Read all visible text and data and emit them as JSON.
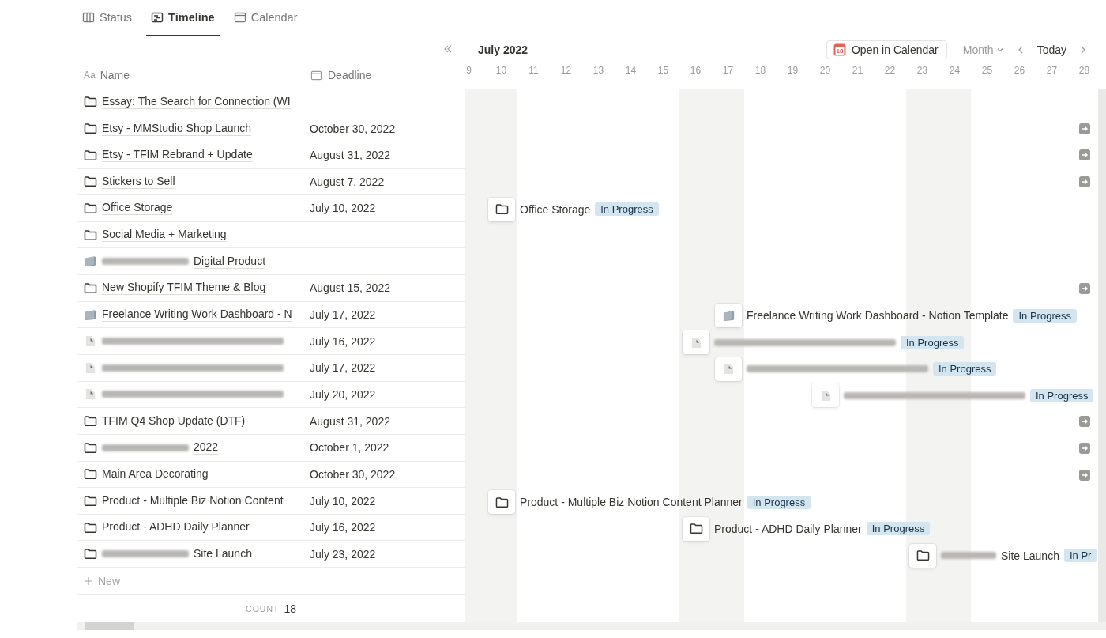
{
  "tabs": [
    {
      "label": "Status",
      "kind": "board",
      "selected": false
    },
    {
      "label": "Timeline",
      "kind": "timeline",
      "selected": true
    },
    {
      "label": "Calendar",
      "kind": "calendar",
      "selected": false
    }
  ],
  "columns": [
    {
      "label": "Name",
      "icon_text": "Aa"
    },
    {
      "label": "Deadline"
    }
  ],
  "rows": [
    {
      "name": "Essay: The Search for Connection (WI",
      "kind": "folder"
    },
    {
      "name": "Etsy - MMStudio Shop Launch",
      "kind": "folder",
      "deadline": "October 30, 2022",
      "beyond_range": true
    },
    {
      "name": "Etsy - TFIM Rebrand + Update",
      "kind": "folder",
      "deadline": "August 31, 2022",
      "beyond_range": true
    },
    {
      "name": "Stickers to Sell",
      "kind": "folder",
      "deadline": "August 7, 2022",
      "beyond_range": true
    },
    {
      "name": "Office Storage",
      "kind": "folder",
      "deadline": "July 10, 2022",
      "bar": {
        "title": "Office Storage",
        "status": "In Progress"
      }
    },
    {
      "name": "Social Media + Marketing",
      "kind": "folder"
    },
    {
      "name": "Digital Product",
      "kind": "gray-folder",
      "blurred": true
    },
    {
      "name": "New Shopify TFIM Theme & Blog",
      "kind": "folder",
      "deadline": "August 15, 2022",
      "beyond_range": true
    },
    {
      "name": "Freelance Writing Work Dashboard - N",
      "kind": "gray-folder",
      "deadline": "July 17, 2022",
      "bar": {
        "title": "Freelance Writing Work Dashboard - Notion Template",
        "status": "In Progress"
      }
    },
    {
      "kind": "document",
      "blurred": true,
      "deadline": "July 16, 2022",
      "bar": {
        "blurred": true,
        "status": "In Progress"
      }
    },
    {
      "kind": "document",
      "blurred": true,
      "deadline": "July 17, 2022",
      "bar": {
        "blurred": true,
        "status": "In Progress"
      }
    },
    {
      "kind": "document",
      "blurred": true,
      "deadline": "July 20, 2022",
      "bar": {
        "blurred": true,
        "status": "In Progress"
      }
    },
    {
      "name": "TFIM Q4 Shop Update (DTF)",
      "kind": "folder",
      "deadline": "August 31, 2022",
      "beyond_range": true
    },
    {
      "name": "2022",
      "kind": "folder",
      "blurred": true,
      "deadline": "October 1, 2022",
      "beyond_range": true
    },
    {
      "name": "Main Area Decorating",
      "kind": "folder",
      "deadline": "October 30, 2022",
      "beyond_range": true
    },
    {
      "name": "Product - Multiple Biz Notion Content",
      "kind": "folder",
      "deadline": "July 10, 2022",
      "bar": {
        "title": "Product - Multiple Biz Notion Content Planner",
        "status": "In Progress"
      }
    },
    {
      "name": "Product - ADHD Daily Planner",
      "kind": "folder",
      "deadline": "July 16, 2022",
      "bar": {
        "title": "Product - ADHD Daily Planner",
        "status": "In Progress"
      }
    },
    {
      "name": "Site Launch",
      "kind": "folder",
      "blurred": true,
      "deadline": "July 23, 2022",
      "bar": {
        "blurred": true,
        "title": "Site Launch",
        "status": "In Pr"
      }
    }
  ],
  "new_row": {
    "label": "New"
  },
  "count": {
    "label": "COUNT",
    "value": "18"
  },
  "timeline": {
    "month": "July 2022",
    "open_button": "Open in Calendar",
    "calendar_icon_day": "18",
    "view": "Month",
    "today": "Today",
    "days": [
      {
        "label": "9",
        "weekend": true
      },
      {
        "label": "10",
        "weekend": true
      },
      {
        "label": "11",
        "weekend": false
      },
      {
        "label": "12",
        "weekend": false
      },
      {
        "label": "13",
        "weekend": false
      },
      {
        "label": "14",
        "weekend": false
      },
      {
        "label": "15",
        "weekend": false
      },
      {
        "label": "16",
        "weekend": true
      },
      {
        "label": "17",
        "weekend": true
      },
      {
        "label": "18",
        "weekend": false
      },
      {
        "label": "19",
        "weekend": false
      },
      {
        "label": "20",
        "weekend": false
      },
      {
        "label": "21",
        "weekend": false
      },
      {
        "label": "22",
        "weekend": false
      },
      {
        "label": "23",
        "weekend": true
      },
      {
        "label": "24",
        "weekend": true
      },
      {
        "label": "25",
        "weekend": false
      },
      {
        "label": "26",
        "weekend": false
      },
      {
        "label": "27",
        "weekend": false
      },
      {
        "label": "28",
        "weekend": false
      }
    ]
  }
}
